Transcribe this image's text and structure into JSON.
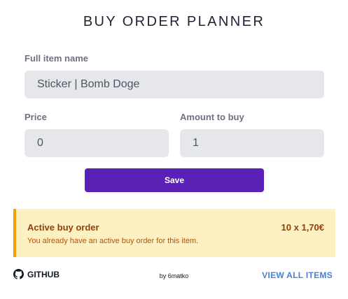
{
  "header": {
    "title": "BUY ORDER PLANNER"
  },
  "form": {
    "item_name": {
      "label": "Full item name",
      "value": "Sticker | Bomb Doge"
    },
    "price": {
      "label": "Price",
      "value": "0"
    },
    "amount": {
      "label": "Amount to buy",
      "value": "1"
    },
    "save_label": "Save"
  },
  "alert": {
    "title": "Active buy order",
    "amount": "10 x 1,70€",
    "message": "You already have an active buy order for this item.",
    "colors": {
      "background": "#fdf0c2",
      "accent": "#f59e0b",
      "text": "#92400e"
    }
  },
  "footer": {
    "github_label": "GITHUB",
    "github_icon": "github-icon",
    "author": "by 6matko",
    "view_all_label": "VIEW ALL ITEMS"
  },
  "colors": {
    "primary_button": "#5b21b6",
    "link": "#4a7fd6"
  }
}
